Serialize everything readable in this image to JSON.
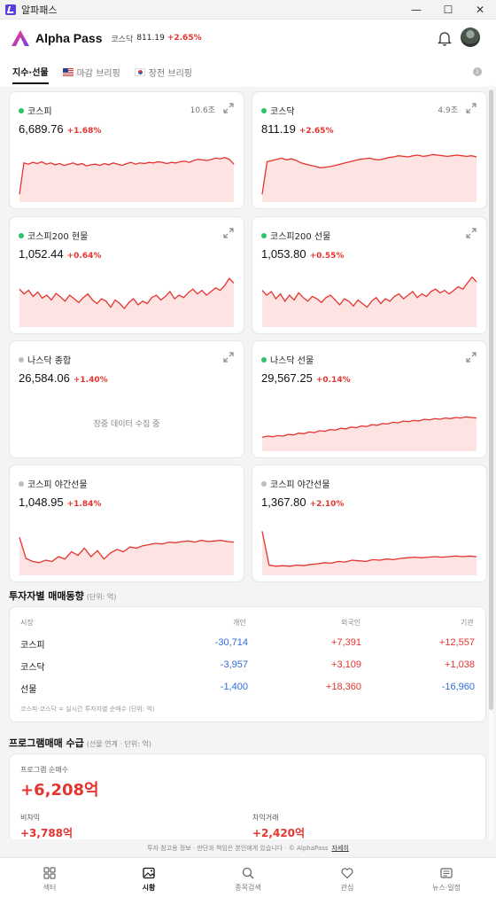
{
  "window": {
    "title": "알파패스",
    "controls": [
      "minimize",
      "maximize",
      "close"
    ]
  },
  "header": {
    "brand": "Alpha Pass",
    "ticker_name": "코스닥",
    "ticker_value": "811.19",
    "ticker_change": "+2.65%"
  },
  "tabs": [
    {
      "label": "지수·선물",
      "active": true
    },
    {
      "label": "마감 브리핑",
      "icon": "us-flag-icon"
    },
    {
      "label": "장전 브리핑",
      "icon": "kr-flag-icon"
    }
  ],
  "cards": [
    {
      "name": "코스피",
      "volume": "10.6조",
      "price": "6,689.76",
      "change": "+1.68%",
      "live": true,
      "series": [
        10,
        62,
        60,
        63,
        61,
        64,
        60,
        62,
        59,
        61,
        58,
        60,
        62,
        59,
        61,
        57,
        59,
        60,
        58,
        61,
        59,
        62,
        60,
        58,
        61,
        63,
        60,
        62,
        61,
        63,
        62,
        64,
        63,
        61,
        63,
        62,
        64,
        65,
        63,
        66,
        68,
        67,
        66,
        68,
        70,
        69,
        71,
        68,
        60
      ]
    },
    {
      "name": "코스닥",
      "volume": "4.9조",
      "price": "811.19",
      "change": "+2.65%",
      "live": true,
      "series": [
        10,
        64,
        66,
        68,
        70,
        67,
        69,
        66,
        62,
        60,
        58,
        56,
        54,
        55,
        56,
        58,
        60,
        62,
        64,
        66,
        68,
        69,
        70,
        68,
        67,
        69,
        71,
        72,
        74,
        73,
        72,
        74,
        75,
        73,
        74,
        76,
        75,
        74,
        73,
        74,
        75,
        74,
        73,
        74,
        72
      ]
    },
    {
      "name": "코스피200 현물",
      "volume": "",
      "price": "1,052.44",
      "change": "+0.64%",
      "live": true,
      "series": [
        60,
        52,
        58,
        48,
        55,
        45,
        50,
        42,
        53,
        47,
        40,
        50,
        44,
        38,
        46,
        52,
        42,
        36,
        44,
        40,
        30,
        42,
        36,
        28,
        38,
        44,
        34,
        40,
        36,
        46,
        50,
        42,
        48,
        56,
        44,
        50,
        46,
        54,
        60,
        52,
        58,
        50,
        56,
        62,
        58,
        66,
        78,
        70
      ]
    },
    {
      "name": "코스피200 선물",
      "volume": "",
      "price": "1,053.80",
      "change": "+0.55%",
      "live": true,
      "series": [
        58,
        50,
        56,
        44,
        52,
        40,
        50,
        42,
        54,
        46,
        40,
        48,
        44,
        38,
        46,
        50,
        42,
        34,
        44,
        40,
        32,
        42,
        36,
        30,
        40,
        46,
        36,
        44,
        40,
        48,
        52,
        44,
        50,
        56,
        46,
        52,
        48,
        56,
        60,
        54,
        58,
        52,
        58,
        64,
        60,
        70,
        80,
        72
      ]
    },
    {
      "name": "나스닥 종합",
      "volume": "",
      "price": "26,584.06",
      "change": "+1.40%",
      "live": false,
      "status_text": "장중 데이터 수집 중",
      "series": []
    },
    {
      "name": "나스닥 선물",
      "volume": "",
      "price": "29,567.25",
      "change": "+0.14%",
      "live": true,
      "series": [
        20,
        22,
        21,
        23,
        22,
        25,
        24,
        27,
        26,
        29,
        28,
        31,
        30,
        33,
        32,
        35,
        34,
        37,
        36,
        39,
        38,
        41,
        40,
        43,
        42,
        45,
        44,
        47,
        46,
        48,
        47,
        50,
        49,
        51,
        50,
        52,
        51,
        53,
        52,
        54,
        53,
        52
      ]
    },
    {
      "name": "코스피 야간선물",
      "volume": "",
      "price": "1,048.95",
      "change": "+1.84%",
      "live": false,
      "series": [
        60,
        25,
        20,
        18,
        22,
        20,
        28,
        24,
        36,
        30,
        42,
        28,
        38,
        24,
        34,
        40,
        36,
        44,
        42,
        46,
        48,
        50,
        49,
        52,
        51,
        53,
        54,
        52,
        55,
        53,
        54,
        55,
        53,
        52
      ]
    },
    {
      "name": "코스피 야간선물",
      "volume": "",
      "price": "1,367.80",
      "change": "+2.10%",
      "live": false,
      "series": [
        70,
        14,
        12,
        13,
        12,
        14,
        13,
        15,
        16,
        18,
        17,
        20,
        19,
        22,
        21,
        20,
        23,
        22,
        24,
        23,
        25,
        26,
        27,
        26,
        27,
        28,
        27,
        28,
        29,
        28,
        29,
        28
      ]
    }
  ],
  "investor": {
    "title": "투자자별 매매동향",
    "unit": "(단위: 억)",
    "columns": [
      "시장",
      "개인",
      "외국인",
      "기관"
    ],
    "rows": [
      {
        "market": "코스피",
        "individual": "-30,714",
        "foreign": "+7,391",
        "institution": "+12,557"
      },
      {
        "market": "코스닥",
        "individual": "-3,957",
        "foreign": "+3,109",
        "institution": "+1,038"
      },
      {
        "market": "선물",
        "individual": "-1,400",
        "foreign": "+18,360",
        "institution": "-16,960"
      }
    ],
    "note": "코스피·코스닥 = 실시간 투자자별 순매수 (단위: 억)"
  },
  "program": {
    "title": "프로그램매매 수급",
    "unit": "(선물 연계 · 단위: 억)",
    "net_label": "프로그램 순매수",
    "net_value": "+6,208억",
    "nonarb_label": "비차익",
    "nonarb_value": "+3,788억",
    "arb_label": "차익거래",
    "arb_value": "+2,420억"
  },
  "disclaimer": {
    "text": "투자 참고용 정보 · 판단과 책임은 본인에게 있습니다 · © AlphaPass",
    "link": "자세히"
  },
  "bottom_nav": [
    {
      "label": "섹터",
      "icon": "grid-icon"
    },
    {
      "label": "시황",
      "icon": "image-icon",
      "active": true
    },
    {
      "label": "종목검색",
      "icon": "search-icon"
    },
    {
      "label": "관심",
      "icon": "heart-icon"
    },
    {
      "label": "뉴스·일정",
      "icon": "news-icon"
    }
  ],
  "colors": {
    "up": "#e5342f",
    "down": "#2f6ad8",
    "live_dot": "#2cc36b",
    "accent": "#e02a6a"
  }
}
